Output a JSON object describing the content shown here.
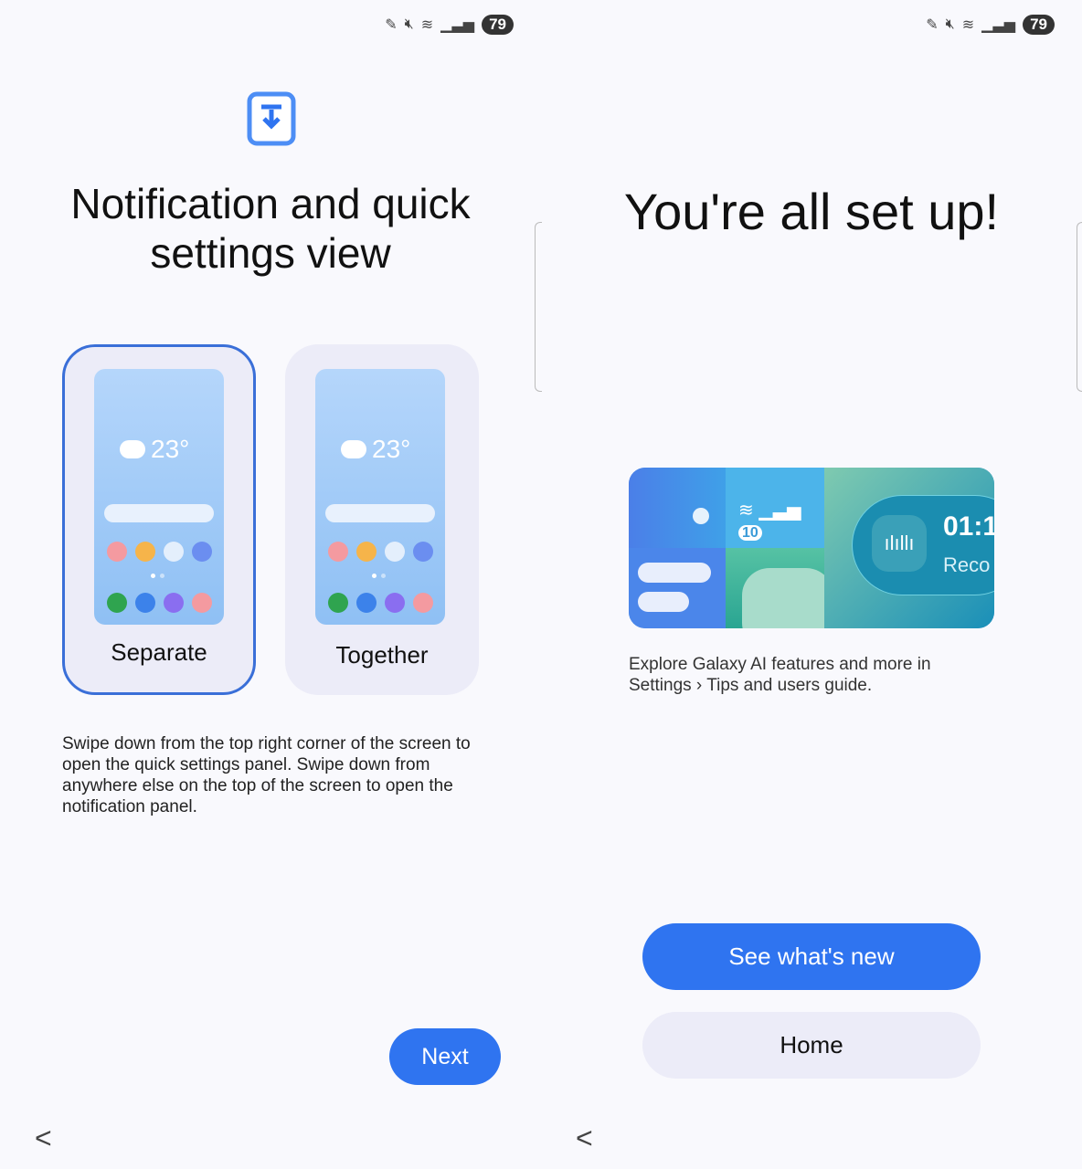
{
  "status_bar": {
    "battery": "79",
    "icons": [
      "pen-icon",
      "mute-icon",
      "wifi-icon",
      "signal-icon"
    ]
  },
  "left": {
    "title_line1": "Notification and quick",
    "title_line2": "settings view",
    "header_icon": "download-panel-icon",
    "options": [
      {
        "label": "Separate",
        "selected": true,
        "temp": "23°"
      },
      {
        "label": "Together",
        "selected": false,
        "temp": "23°"
      }
    ],
    "description": "Swipe down from the top right corner of the screen to open the quick settings panel. Swipe down from anywhere else on the top of the screen to open the notification panel.",
    "next_label": "Next"
  },
  "right": {
    "title": "You're all set up!",
    "hero": {
      "badge": "10",
      "time": "01:1",
      "rec": "Reco"
    },
    "info_line1": "Explore Galaxy AI features and more in",
    "info_line2": "Settings › Tips and users guide.",
    "primary_label": "See what's new",
    "secondary_label": "Home"
  },
  "colors": {
    "accent": "#2f74f0",
    "selected_border": "#3a6fd8"
  }
}
